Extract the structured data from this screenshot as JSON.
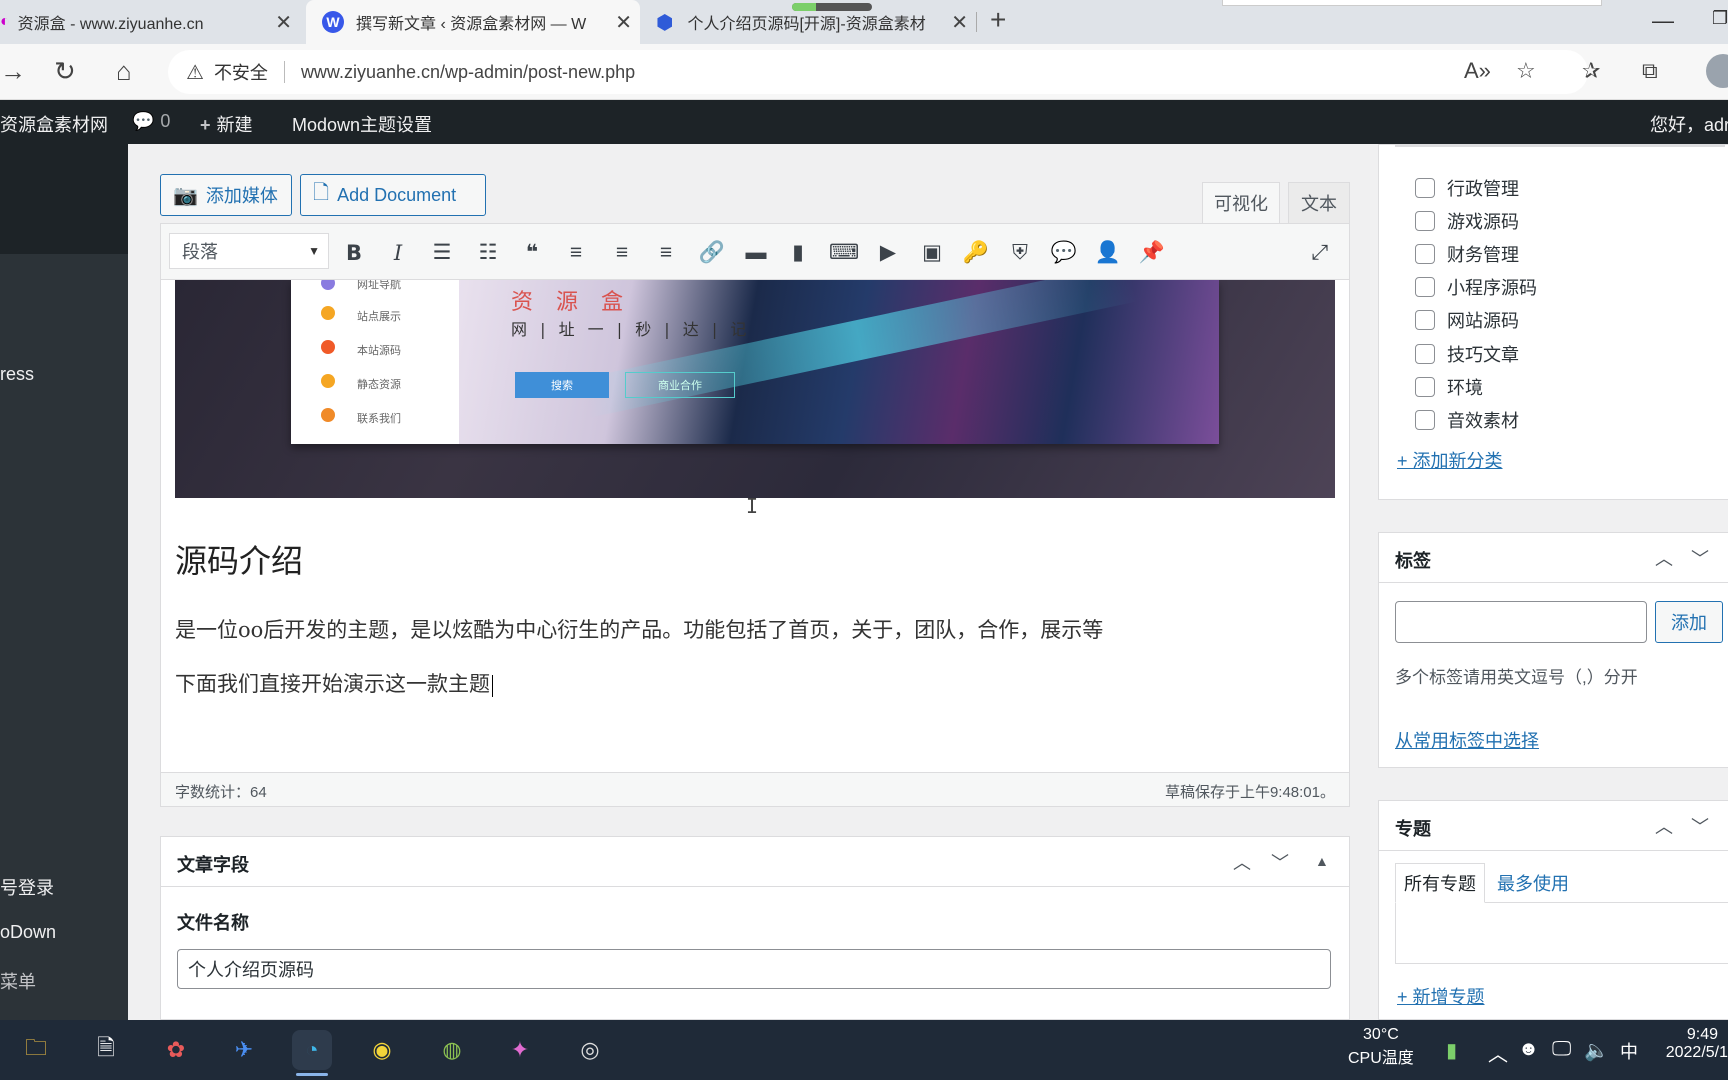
{
  "browser": {
    "tabs": [
      {
        "title": "资源盒 - www.ziyuanhe.cn"
      },
      {
        "title": "撰写新文章 ‹ 资源盒素材网 — W"
      },
      {
        "title": "个人介绍页源码[开源]-资源盒素材"
      }
    ],
    "security_label": "不安全",
    "url": "www.ziyuanhe.cn/wp-admin/post-new.php",
    "load_progress_percent": 30
  },
  "admin_bar": {
    "site_name": "资源盒素材网",
    "comments_count": "0",
    "new_label": "新建",
    "theme_settings": "Modown主题设置",
    "greeting": "您好，adr"
  },
  "admin_menu": {
    "items": [
      "ress",
      "号登录",
      "oDown",
      "菜单"
    ]
  },
  "editor": {
    "add_media": "添加媒体",
    "add_document": "Add Document",
    "tab_visual": "可视化",
    "tab_text": "文本",
    "format_select": "段落",
    "banner": {
      "brand": "资 源 盒",
      "slogan": "网 | 址 一 | 秒 | 达 | 记",
      "menu": [
        "网址导航",
        "站点展示",
        "本站源码",
        "静态资源",
        "联系我们"
      ],
      "search_btn": "搜索",
      "ghost_btn": "商业合作"
    },
    "heading": "源码介绍",
    "paragraphs": [
      "是一位oo后开发的主题，是以炫酷为中心衍生的产品。功能包括了首页，关于，团队，合作，展示等",
      "下面我们直接开始演示这一款主题"
    ],
    "word_count": "字数统计：64",
    "draft_saved": "草稿保存于上午9:48:01。"
  },
  "post_fields": {
    "title": "文章字段",
    "file_name_label": "文件名称",
    "file_name_value": "个人介绍页源码"
  },
  "categories": {
    "items": [
      "行政管理",
      "游戏源码",
      "财务管理",
      "小程序源码",
      "网站源码",
      "技巧文章",
      "环境",
      "音效素材"
    ],
    "add_new": "+ 添加新分类"
  },
  "tags": {
    "title": "标签",
    "add_button": "添加",
    "hint": "多个标签请用英文逗号（,）分开",
    "choose_common": "从常用标签中选择"
  },
  "topics": {
    "title": "专题",
    "tab_all": "所有专题",
    "tab_most_used": "最多使用",
    "add_new": "+ 新增专题"
  },
  "taskbar": {
    "temperature": "30°C",
    "cpu_label": "CPU温度",
    "ime": "中",
    "time": "9:49",
    "date": "2022/5/1"
  }
}
